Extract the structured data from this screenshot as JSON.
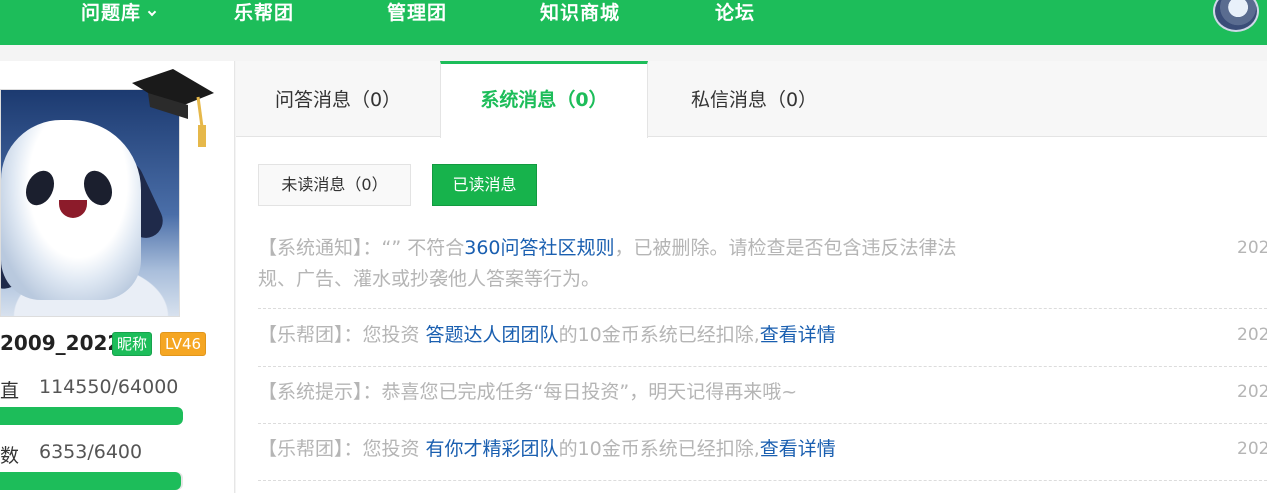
{
  "nav": {
    "items": [
      "问题库",
      "乐帮团",
      "管理团",
      "知识商城",
      "论坛"
    ]
  },
  "profile": {
    "username": "2009_2022",
    "badge_nickname": "昵称",
    "badge_level": "LV46",
    "stats": [
      {
        "label": "直",
        "value": "114550/64000",
        "progress": 1.0
      },
      {
        "label": "数",
        "value": "6353/6400",
        "progress": 0.99
      }
    ]
  },
  "tabs": [
    {
      "label": "问答消息（0）",
      "active": false
    },
    {
      "label": "系统消息（0）",
      "active": true
    },
    {
      "label": "私信消息（0）",
      "active": false
    }
  ],
  "filters": {
    "unread_label": "未读消息（0）",
    "read_label": "已读消息"
  },
  "messages": [
    {
      "prefix": "【系统通知】：“” 不符合",
      "link": "360问答社区规则",
      "suffix": "，已被删除。请检查是否包含违反法律法规、广告、灌水或抄袭他人答案等行为。",
      "date": "202"
    },
    {
      "prefix": "【乐帮团】：您投资 ",
      "link": "答题达人团团队",
      "suffix": "的10金币系统已经扣除,",
      "link2": "查看详情",
      "date": "202"
    },
    {
      "prefix": "【系统提示】：恭喜您已完成任务“每日投资”，明天记得再来哦~",
      "date": "202"
    },
    {
      "prefix": "【乐帮团】：您投资 ",
      "link": "有你才精彩团队",
      "suffix": "的10金币系统已经扣除,",
      "link2": "查看详情",
      "date": "202"
    }
  ],
  "colors": {
    "brand_green": "#1dbd5a",
    "link_blue": "#1a5fb0",
    "muted_text": "#b5b5b5"
  }
}
